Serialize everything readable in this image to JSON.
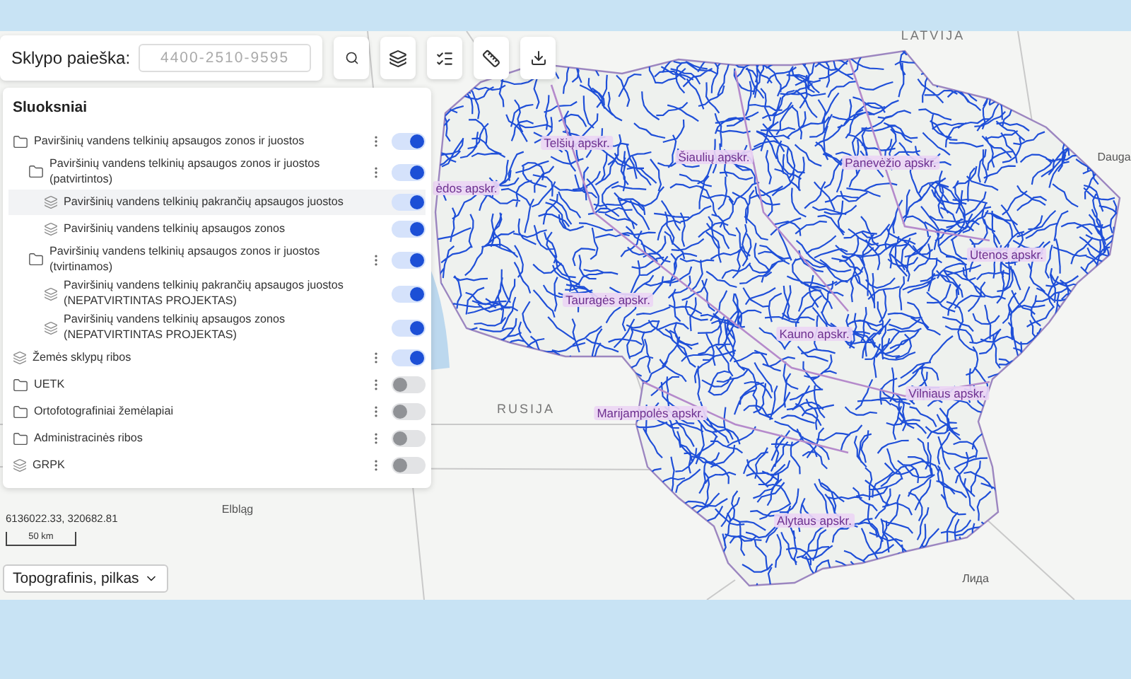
{
  "toolbar": {
    "search": {
      "label": "Sklypo paieška:",
      "placeholder": "4400-2510-9595"
    }
  },
  "layers_panel": {
    "title": "Sluoksniai",
    "items": [
      {
        "kind": "folder",
        "label": "Paviršinių vandens telkinių apsaugos zonos ir juostos",
        "menu": true,
        "on": true,
        "selected": false,
        "children": [
          {
            "kind": "folder",
            "label": "Paviršinių vandens telkinių apsaugos zonos ir juostos (patvirtintos)",
            "menu": true,
            "on": true,
            "selected": false,
            "children": [
              {
                "kind": "layer",
                "label": "Paviršinių vandens telkinių pakrančių apsaugos juostos",
                "menu": false,
                "on": true,
                "selected": true
              },
              {
                "kind": "layer",
                "label": "Paviršinių vandens telkinių apsaugos zonos",
                "menu": false,
                "on": true,
                "selected": false
              }
            ]
          },
          {
            "kind": "folder",
            "label": "Paviršinių vandens telkinių apsaugos zonos ir juostos (tvirtinamos)",
            "menu": true,
            "on": true,
            "selected": false,
            "children": [
              {
                "kind": "layer",
                "label": "Paviršinių vandens telkinių pakrančių apsaugos juostos (NEPATVIRTINTAS PROJEKTAS)",
                "menu": false,
                "on": true,
                "selected": false
              },
              {
                "kind": "layer",
                "label": "Paviršinių vandens telkinių apsaugos zonos (NEPATVIRTINTAS PROJEKTAS)",
                "menu": false,
                "on": true,
                "selected": false
              }
            ]
          }
        ]
      },
      {
        "kind": "layer",
        "label": "Žemės sklypų ribos",
        "menu": true,
        "on": true,
        "selected": false
      },
      {
        "kind": "folder",
        "label": "UETK",
        "menu": true,
        "on": false,
        "selected": false
      },
      {
        "kind": "folder",
        "label": "Ortofotografiniai žemėlapiai",
        "menu": true,
        "on": false,
        "selected": false
      },
      {
        "kind": "folder",
        "label": "Administracinės ribos",
        "menu": true,
        "on": false,
        "selected": false
      },
      {
        "kind": "layer",
        "label": "GRPK",
        "menu": true,
        "on": false,
        "selected": false
      }
    ]
  },
  "coordinates": "6136022.33, 320682.81",
  "scale": "50 km",
  "basemap": {
    "value": "Topografinis, pilkas"
  },
  "map": {
    "labels": [
      {
        "kind": "country",
        "text": "LATVIJA"
      },
      {
        "kind": "county",
        "text": "Telšių apskr."
      },
      {
        "kind": "county",
        "text": "Šiaulių apskr."
      },
      {
        "kind": "county",
        "text": "Panevėžio apskr."
      },
      {
        "kind": "county",
        "text": "ėdos apskr."
      },
      {
        "kind": "city",
        "text": "Dauga"
      },
      {
        "kind": "county",
        "text": "Utenos apskr."
      },
      {
        "kind": "county",
        "text": "Tauragės apskr."
      },
      {
        "kind": "county",
        "text": "Kauno apskr."
      },
      {
        "kind": "county",
        "text": "Vilniaus apskr."
      },
      {
        "kind": "country",
        "text": "RUSIJA"
      },
      {
        "kind": "county",
        "text": "Marijampolės apskr."
      },
      {
        "kind": "city",
        "text": "Elbląg"
      },
      {
        "kind": "county",
        "text": "Alytaus apskr."
      },
      {
        "kind": "city",
        "text": "Лида"
      }
    ]
  }
}
